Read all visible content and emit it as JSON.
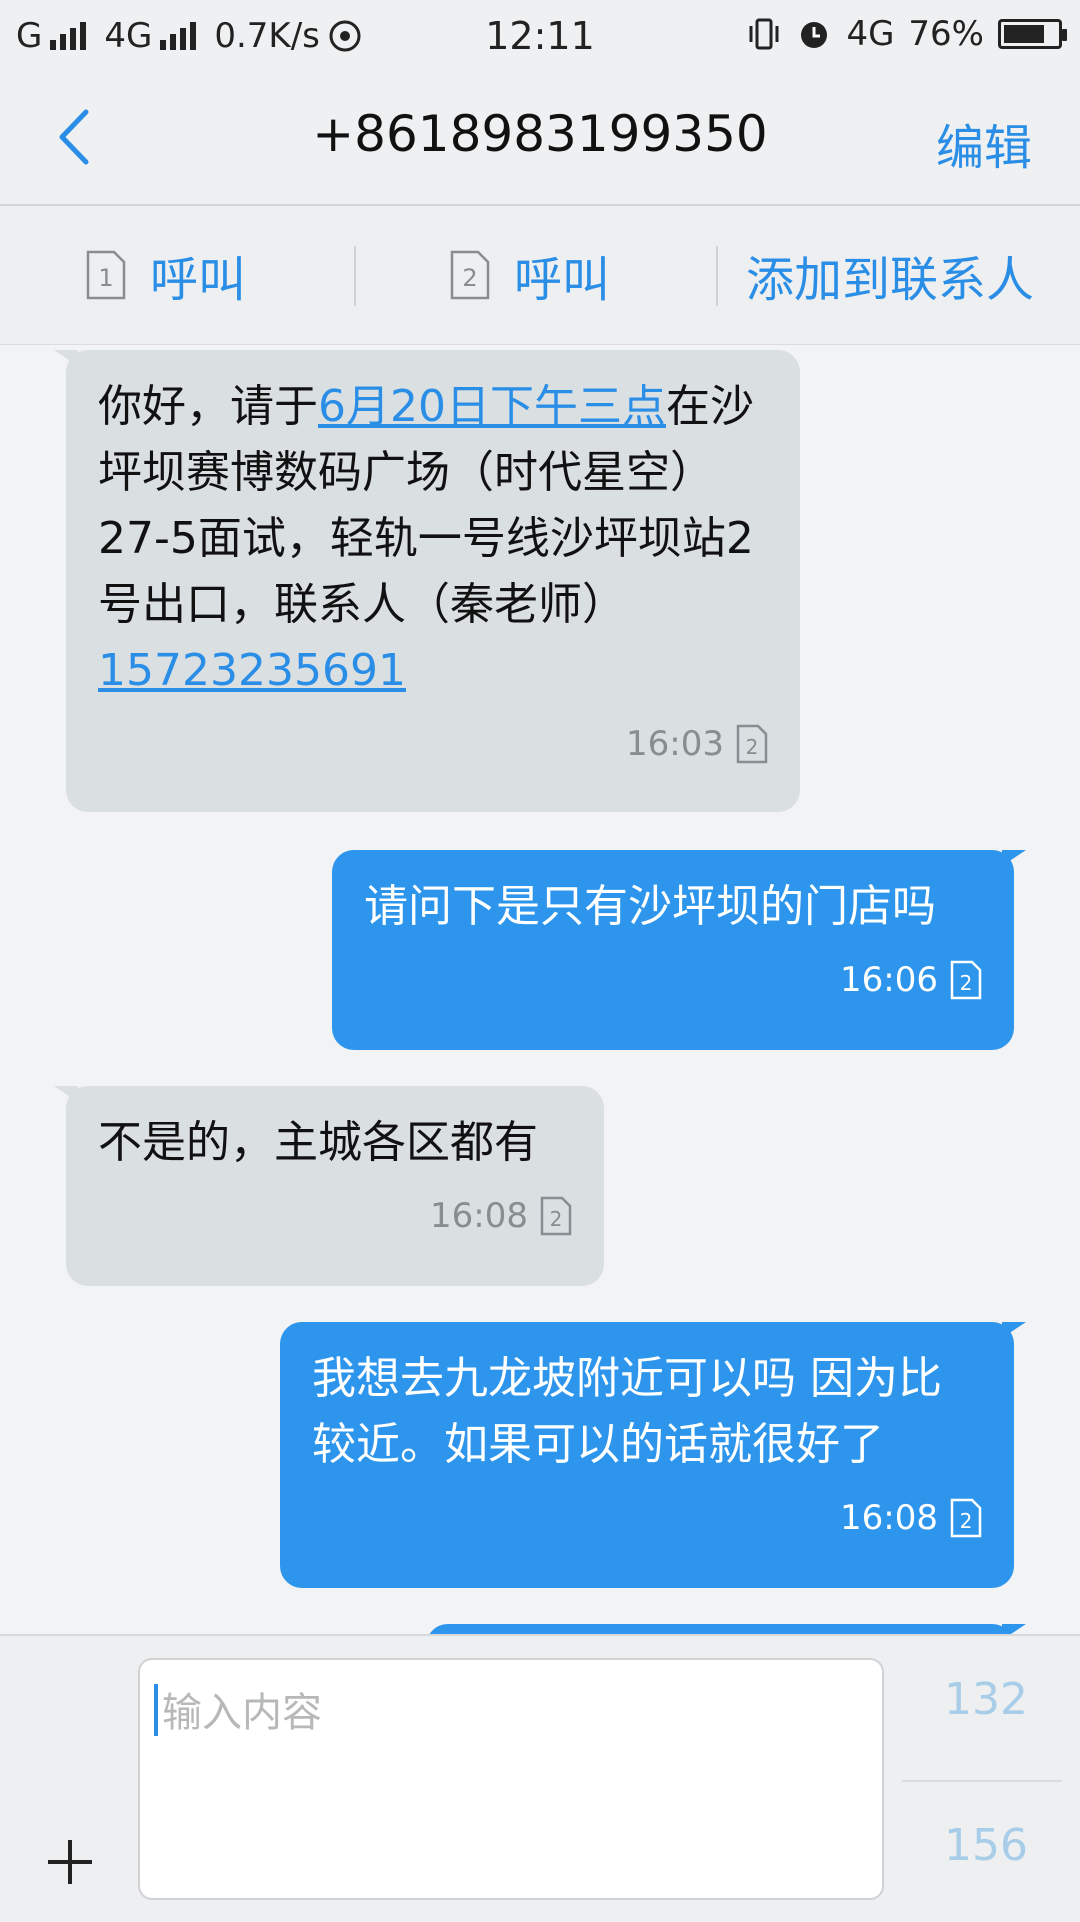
{
  "status_bar": {
    "carrier1": "G",
    "carrier2": "4G",
    "speed": "0.7K/s",
    "time": "12:11",
    "network": "4G",
    "battery": "76%",
    "battery_level": 0.76
  },
  "header": {
    "contact": "+8618983199350",
    "edit_label": "编辑"
  },
  "actions": {
    "call1_label": "呼叫",
    "call2_label": "呼叫",
    "add_contact_label": "添加到联系人",
    "sim1": "1",
    "sim2": "2"
  },
  "messages": [
    {
      "direction": "incoming",
      "text_before": "你好，请于",
      "link_date": "6月20日下午三点",
      "text_middle": "在沙坪坝赛博数码广场（时代星空）27-5面试，轻轨一号线沙坪坝站2号出口，联系人（秦老师）",
      "link_phone": "15723235691",
      "time": "16:03",
      "sim": "2"
    },
    {
      "direction": "outgoing",
      "text": "请问下是只有沙坪坝的门店吗",
      "time": "16:06",
      "sim": "2"
    },
    {
      "direction": "incoming",
      "text": "不是的，主城各区都有",
      "time": "16:08",
      "sim": "2"
    },
    {
      "direction": "outgoing",
      "text": "我想去九龙坡附近可以吗 因为比较近。如果可以的话就很好了",
      "time": "16:08",
      "sim": "2"
    }
  ],
  "composer": {
    "placeholder": "输入内容",
    "count_sim1": "132",
    "count_sim2": "156"
  },
  "colors": {
    "accent": "#2b8ee6",
    "outgoing_bubble": "#2d96ec",
    "incoming_bubble": "#dadfe2"
  }
}
